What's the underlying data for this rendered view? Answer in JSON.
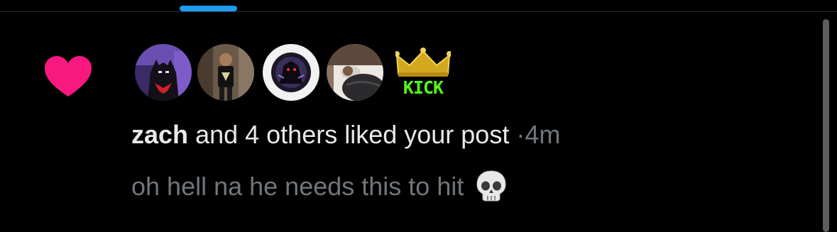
{
  "notification": {
    "type_icon": "heart-icon",
    "accent_color": "#f91880",
    "avatars": [
      {
        "name": "avatar-batman-beyond"
      },
      {
        "name": "avatar-person-standing"
      },
      {
        "name": "avatar-dark-figure"
      },
      {
        "name": "avatar-person-sleeping"
      }
    ],
    "badge": {
      "icon": "crown-icon",
      "label": "KICK"
    },
    "summary": {
      "username": "zach",
      "action": "and 4 others liked your post",
      "separator": "·",
      "time": "4m"
    },
    "post_preview": {
      "text": "oh hell na he needs this to hit",
      "emoji": "skull-icon"
    }
  },
  "colors": {
    "background": "#000000",
    "text_primary": "#e7e9ea",
    "text_secondary": "#71767b",
    "tab_indicator": "#1d9bf0"
  }
}
